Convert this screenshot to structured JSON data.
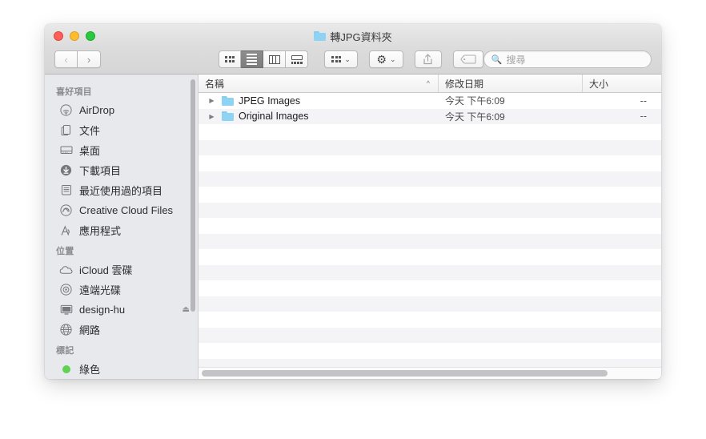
{
  "window": {
    "title": "轉JPG資料夾",
    "title_icon": "folder-icon",
    "traffic_lights": [
      {
        "name": "close-button",
        "color": "#ff5f57"
      },
      {
        "name": "minimize-button",
        "color": "#ffbd2e"
      },
      {
        "name": "maximize-button",
        "color": "#28c840"
      }
    ]
  },
  "toolbar": {
    "back_label": "‹",
    "forward_label": "›",
    "view_modes": [
      {
        "name": "icon-view-button",
        "icon": "grid-icon",
        "active": false
      },
      {
        "name": "list-view-button",
        "icon": "list-icon",
        "active": true
      },
      {
        "name": "column-view-button",
        "icon": "columns-icon",
        "active": false
      },
      {
        "name": "gallery-view-button",
        "icon": "gallery-icon",
        "active": false
      }
    ],
    "arrange_icon": "arrange-grid-icon",
    "action_icon": "gear-icon",
    "share_icon": "share-icon",
    "tag_icon": "tag-icon",
    "caret": "⌄"
  },
  "search": {
    "icon": "search-icon",
    "placeholder": "搜尋",
    "value": ""
  },
  "sidebar": {
    "sections": [
      {
        "header": "喜好項目",
        "items": [
          {
            "label": "AirDrop",
            "icon": "airdrop-icon"
          },
          {
            "label": "文件",
            "icon": "documents-icon"
          },
          {
            "label": "桌面",
            "icon": "desktop-icon"
          },
          {
            "label": "下載項目",
            "icon": "downloads-icon"
          },
          {
            "label": "最近使用過的項目",
            "icon": "recents-icon"
          },
          {
            "label": "Creative Cloud Files",
            "icon": "creative-cloud-icon"
          },
          {
            "label": "應用程式",
            "icon": "applications-icon"
          }
        ]
      },
      {
        "header": "位置",
        "items": [
          {
            "label": "iCloud 雲碟",
            "icon": "icloud-icon"
          },
          {
            "label": "遠端光碟",
            "icon": "disc-icon"
          },
          {
            "label": "design-hu",
            "icon": "computer-icon",
            "eject": "⏏"
          },
          {
            "label": "網路",
            "icon": "network-icon"
          }
        ]
      },
      {
        "header": "標記",
        "items": [
          {
            "label": "綠色",
            "icon": "green-tag-dot",
            "color": "#5fd24f"
          }
        ]
      }
    ]
  },
  "filelist": {
    "columns": [
      {
        "label": "名稱",
        "sort": "^"
      },
      {
        "label": "修改日期",
        "sort": ""
      },
      {
        "label": "大小",
        "sort": ""
      }
    ],
    "rows": [
      {
        "name": "JPEG Images",
        "date": "今天 下午6:09",
        "size": "--",
        "icon": "folder-icon",
        "twisty": "▶"
      },
      {
        "name": "Original Images",
        "date": "今天 下午6:09",
        "size": "--",
        "icon": "folder-icon",
        "twisty": "▶"
      }
    ],
    "blank_row_count": 16
  }
}
